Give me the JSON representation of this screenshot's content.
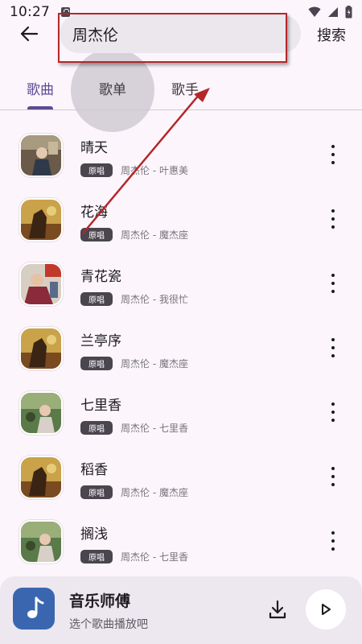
{
  "status_bar": {
    "time": "10:27",
    "icons": [
      "notification-icon",
      "wifi-icon",
      "signal-icon",
      "battery-icon"
    ]
  },
  "search": {
    "query": "周杰伦",
    "back_icon": "arrow-left-icon",
    "submit_label": "搜索"
  },
  "tabs": [
    {
      "label": "歌曲",
      "selected": true
    },
    {
      "label": "歌单",
      "selected": false
    },
    {
      "label": "歌手",
      "selected": false
    }
  ],
  "badge_label": "原唱",
  "songs": [
    {
      "title": "晴天",
      "subtitle": "周杰伦 - 叶惠美"
    },
    {
      "title": "花海",
      "subtitle": "周杰伦 - 魔杰座"
    },
    {
      "title": "青花瓷",
      "subtitle": "周杰伦 - 我很忙"
    },
    {
      "title": "兰亭序",
      "subtitle": "周杰伦 - 魔杰座"
    },
    {
      "title": "七里香",
      "subtitle": "周杰伦 - 七里香"
    },
    {
      "title": "稻香",
      "subtitle": "周杰伦 - 魔杰座"
    },
    {
      "title": "搁浅",
      "subtitle": "周杰伦 - 七里香"
    }
  ],
  "player": {
    "title": "音乐师傅",
    "subtitle": "选个歌曲播放吧",
    "icons": [
      "music-note-icon",
      "download-icon",
      "play-icon"
    ]
  },
  "colors": {
    "accent": "#5b4b96",
    "background": "#fcf6fc",
    "annotation": "#b3272a",
    "app_icon": "#3a66b0"
  }
}
